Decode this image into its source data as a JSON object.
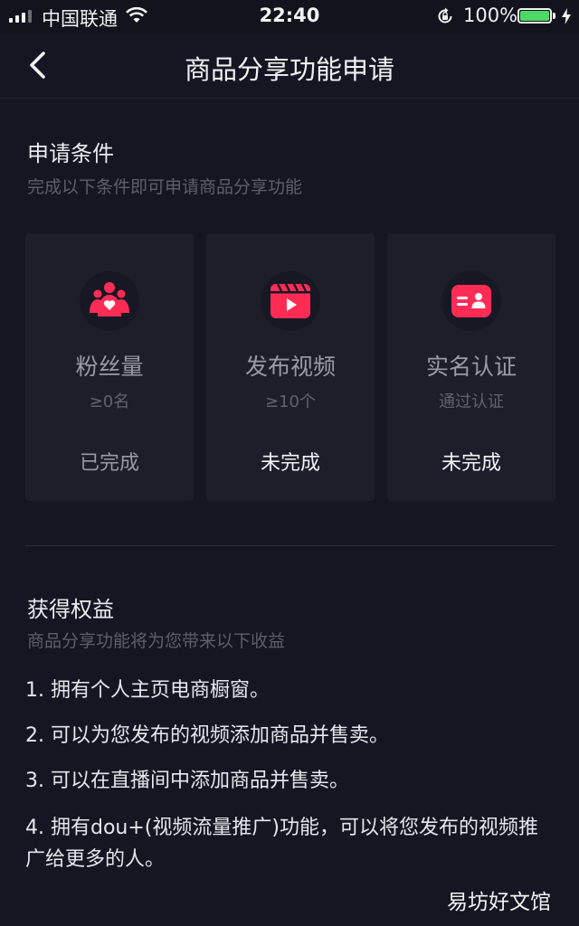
{
  "status_bar": {
    "carrier": "中国联通",
    "time": "22:40",
    "battery_percent": "100%",
    "battery_level": 1.0
  },
  "nav": {
    "title": "商品分享功能申请"
  },
  "conditions": {
    "title": "申请条件",
    "subtitle": "完成以下条件即可申请商品分享功能",
    "cards": [
      {
        "icon": "fans-icon",
        "title": "粉丝量",
        "requirement": "≥0名",
        "status": "已完成"
      },
      {
        "icon": "video-icon",
        "title": "发布视频",
        "requirement": "≥10个",
        "status": "未完成"
      },
      {
        "icon": "id-card-icon",
        "title": "实名认证",
        "requirement": "通过认证",
        "status": "未完成"
      }
    ]
  },
  "benefits": {
    "title": "获得权益",
    "subtitle": "商品分享功能将为您带来以下收益",
    "items": [
      "1. 拥有个人主页电商橱窗。",
      "2. 可以为您发布的视频添加商品并售卖。",
      "3. 可以在直播间中添加商品并售卖。",
      "4. 拥有dou+(视频流量推广)功能，可以将您发布的视频推广给更多的人。"
    ]
  },
  "watermark": "易坊好文馆",
  "colors": {
    "background": "#161622",
    "card": "#1e1e2b",
    "accent": "#fe2c55",
    "battery": "#4cd964"
  }
}
